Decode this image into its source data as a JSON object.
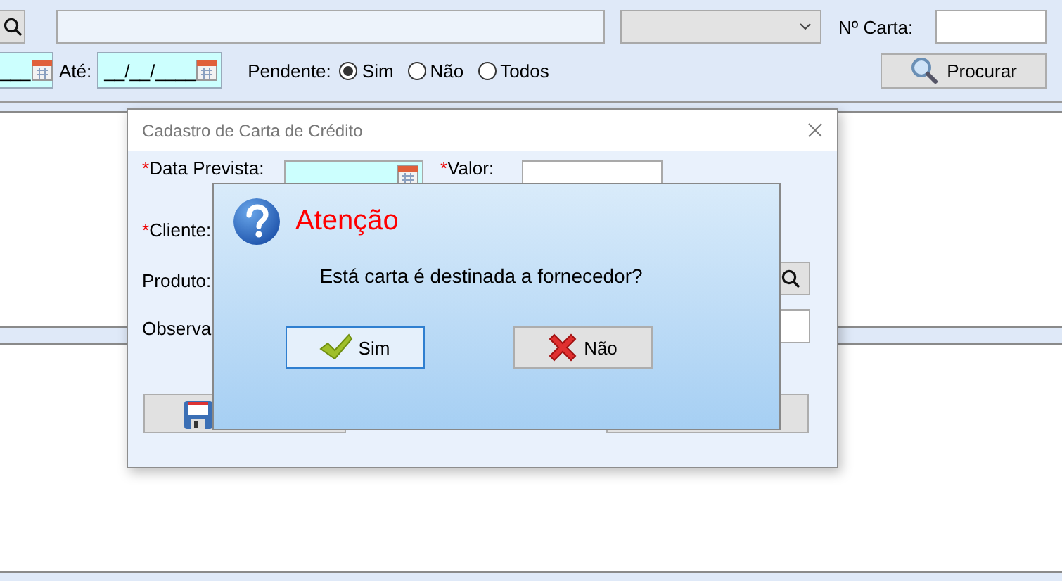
{
  "filter": {
    "date_from": {
      "value": "___"
    },
    "ate_label": "Até:",
    "date_to": {
      "value": "__/__/____"
    },
    "pendente_label": "Pendente:",
    "carta_label": "Nº Carta:",
    "radios": [
      {
        "label": "Sim",
        "selected": true
      },
      {
        "label": "Não",
        "selected": false
      },
      {
        "label": "Todos",
        "selected": false
      }
    ],
    "search_button": "Procurar"
  },
  "dialog": {
    "title": "Cadastro de Carta de Crédito",
    "fields": [
      {
        "marker": "*",
        "label": "Data Prevista:"
      },
      {
        "marker": "*",
        "label": "Valor:"
      },
      {
        "marker": "*",
        "label": "Cliente:"
      },
      {
        "label": "Produto:"
      },
      {
        "label": "Observa"
      }
    ]
  },
  "message_box": {
    "title": "Atenção",
    "message": "Está carta é destinada a fornecedor?",
    "buttons": [
      {
        "label": "Sim",
        "kind": "confirm",
        "focused": true
      },
      {
        "label": "Não",
        "kind": "cancel",
        "focused": false
      }
    ]
  }
}
